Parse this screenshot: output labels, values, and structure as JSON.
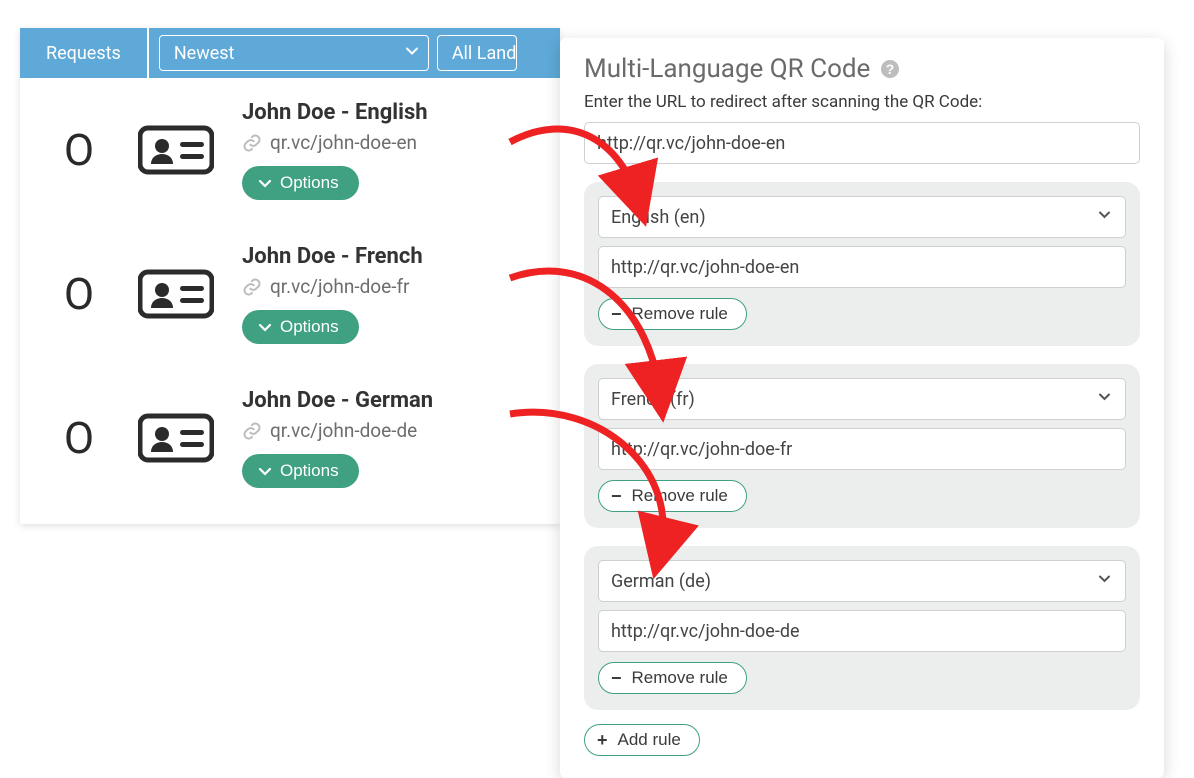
{
  "left": {
    "tab_label": "Requests",
    "sort": "Newest",
    "filter": "All Landi",
    "rows": [
      {
        "count": "O",
        "title": "John Doe - English",
        "url": "qr.vc/john-doe-en",
        "options": "Options"
      },
      {
        "count": "O",
        "title": "John Doe - French",
        "url": "qr.vc/john-doe-fr",
        "options": "Options"
      },
      {
        "count": "O",
        "title": "John Doe - German",
        "url": "qr.vc/john-doe-de",
        "options": "Options"
      }
    ]
  },
  "right": {
    "title": "Multi-Language QR Code",
    "subtitle": "Enter the URL to redirect after scanning the QR Code:",
    "main_url": "http://qr.vc/john-doe-en",
    "rules": [
      {
        "lang": "English (en)",
        "url": "http://qr.vc/john-doe-en",
        "remove": "Remove rule"
      },
      {
        "lang": "French (fr)",
        "url": "http://qr.vc/john-doe-fr",
        "remove": "Remove rule"
      },
      {
        "lang": "German (de)",
        "url": "http://qr.vc/john-doe-de",
        "remove": "Remove rule"
      }
    ],
    "add_rule": "Add rule"
  }
}
